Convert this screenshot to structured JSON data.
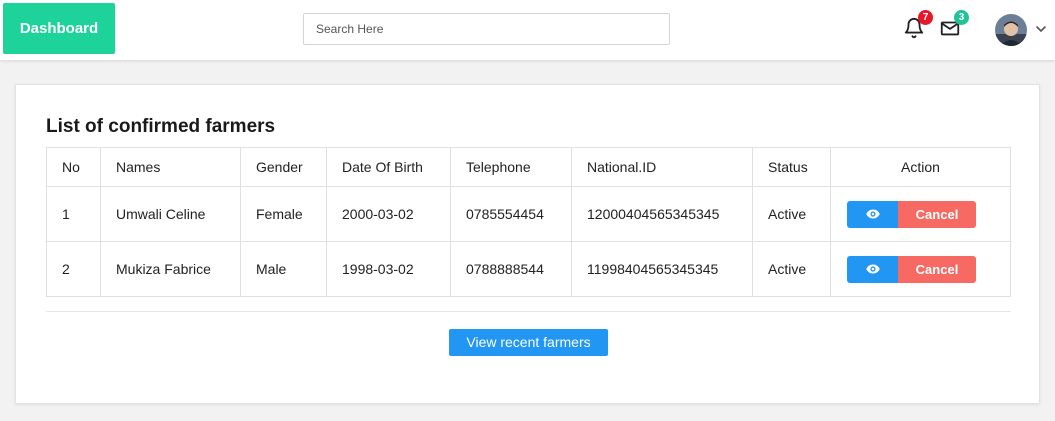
{
  "header": {
    "brand_label": "Dashboard",
    "search_placeholder": "Search Here",
    "notifications_count": "7",
    "messages_count": "3",
    "badge_colors": {
      "notifications": "#e8162a",
      "messages": "#22c497"
    },
    "brand_color": "#1ed39a"
  },
  "main": {
    "title": "List of confirmed farmers",
    "table": {
      "columns": [
        "No",
        "Names",
        "Gender",
        "Date Of Birth",
        "Telephone",
        "National.ID",
        "Status",
        "Action"
      ],
      "rows": [
        {
          "no": "1",
          "name": "Umwali Celine",
          "gender": "Female",
          "dob": "2000-03-02",
          "telephone": "0785554454",
          "national_id": "12000404565345345",
          "status": "Active",
          "view_icon": "eye-icon",
          "cancel_label": "Cancel"
        },
        {
          "no": "2",
          "name": "Mukiza Fabrice",
          "gender": "Male",
          "dob": "1998-03-02",
          "telephone": "0788888544",
          "national_id": "11998404565345345",
          "status": "Active",
          "view_icon": "eye-icon",
          "cancel_label": "Cancel"
        }
      ]
    },
    "view_recent_label": "View recent farmers",
    "colors": {
      "primary": "#2196f3",
      "danger": "#f76a63"
    }
  }
}
